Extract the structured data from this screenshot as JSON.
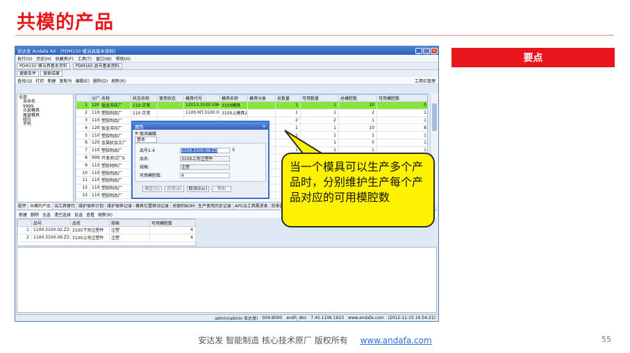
{
  "slide": {
    "title": "共模的产品",
    "key_points": "要点",
    "callout": "当一个模具可以生产多个产品时，分别维护生产每个产品对应的可用模腔数",
    "footer_text": "安达发 智能制造 核心技术原厂 版权所有",
    "footer_link": "www.andafa.com",
    "page_number": "55"
  },
  "app": {
    "title": "安达发 Andafa AX - [PDM150 模治具基本资料]",
    "menu": [
      "执行(O)",
      "历史(H)",
      "收藏夹(F)",
      "工具(T)",
      "窗口(W)",
      "帮助(H)"
    ],
    "doc_tabs": [
      "PDM150 模治具基本资料",
      "PDM160 品号基本资料"
    ],
    "sub_tabs": [
      "搜索条件",
      "搜索结果"
    ],
    "toolbar": [
      "查找(Q)",
      "打印",
      "新建",
      "复制为",
      "编辑(E)",
      "删除(D)",
      "刷新(R)"
    ],
    "toolbar_right": "工具栏管理",
    "tree": [
      "全部",
      "未命名",
      "9999",
      "头部模具",
      "尾部模具",
      "线位",
      "手机"
    ],
    "grid_headers": [
      "",
      "分厂",
      "名称",
      "状态名称",
      "使用状态",
      "模具代号",
      "模具名称",
      "模具分类",
      "总数量",
      "可用数量",
      "总模腔数",
      "可用模腔数"
    ],
    "grid_rows": [
      [
        "1",
        "1205",
        "钣金冲压厂",
        "110 正常",
        "",
        "12013.3100.59MT",
        "3100模具",
        "",
        "1",
        "1",
        "10",
        "0"
      ],
      [
        "2",
        "1100",
        "塑胶制品厂",
        "110 正常",
        "",
        "1100.MT.3100.01-2",
        "3100上模具2",
        "",
        "1",
        "1",
        "2",
        "1"
      ],
      [
        "3",
        "1100",
        "塑胶制品厂",
        "",
        "",
        "",
        "",
        "",
        "2",
        "2",
        "1",
        "1"
      ],
      [
        "4",
        "1205",
        "钣金冲压厂",
        "",
        "",
        "",
        "",
        "",
        "1",
        "1",
        "10",
        "8"
      ],
      [
        "5",
        "1100",
        "塑胶制品厂",
        "",
        "",
        "",
        "",
        "",
        "1",
        "1",
        "1",
        "1"
      ],
      [
        "6",
        "1202",
        "金属机加工厂",
        "",
        "",
        "",
        "",
        "",
        "1",
        "1",
        "0",
        "1"
      ],
      [
        "7",
        "1100",
        "塑胶制品厂",
        "",
        "",
        "",
        "",
        "",
        "1",
        "1",
        "1",
        "1"
      ],
      [
        "8",
        "9999",
        "开发测试厂b",
        "",
        "",
        "",
        "",
        "",
        "1",
        "1",
        "1",
        "1"
      ],
      [
        "9",
        "1103",
        "塑胶材料厂",
        "",
        "",
        "",
        "",
        "",
        "",
        "",
        "",
        ""
      ],
      [
        "10",
        "1100",
        "塑胶制品厂",
        "",
        "",
        "",
        "",
        "",
        "",
        "",
        "",
        ""
      ],
      [
        "11",
        "1100",
        "塑胶制品厂",
        "",
        "",
        "",
        "",
        "",
        "",
        "",
        "",
        ""
      ],
      [
        "12",
        "1100",
        "塑胶制品厂",
        "",
        "",
        "",
        "",
        "",
        "",
        "",
        "",
        ""
      ],
      [
        "13",
        "1100",
        "塑胶制品厂",
        "",
        "",
        "",
        "",
        "",
        "",
        "",
        "",
        ""
      ]
    ],
    "bottom_tabs": [
      "配件",
      "共模的产品",
      "冶工具替代",
      "维护保养计划",
      "维护保养记录",
      "模具位置移动记录",
      "关联的BOM",
      "生产使用历史记录",
      "APS冶工具需求表",
      "的来源"
    ],
    "sub_toolbar": [
      "新建",
      "删除",
      "全选",
      "清空选择",
      "反选",
      "查看",
      "刷新(R)"
    ],
    "sub_headers": [
      "",
      "品号",
      "品名",
      "规格",
      "可用模腔数"
    ],
    "sub_rows": [
      [
        "1",
        "1100.3100.02.Z3",
        "3100下壳注塑件",
        "注塑",
        "4"
      ],
      [
        "2",
        "1100.3100.09.Z3",
        "3100上壳注塑件",
        "注塑",
        "4"
      ]
    ],
    "status": [
      "admin(admin 安达发)",
      "S04:8090",
      "andh_dev",
      "7.45.1106.1623",
      "www.andafa.com",
      "(2012-11-15 16:54:21)"
    ]
  },
  "dialog": {
    "title": "属性",
    "tool": "取消编辑",
    "tab": "基本",
    "fields": [
      {
        "label": "品号1:4",
        "value": "1100.3100.09.Z3"
      },
      {
        "label": "品名:",
        "value": "3100上壳注塑件"
      },
      {
        "label": "规格:",
        "value": "注塑"
      },
      {
        "label": "可用模腔数:",
        "value": "4"
      }
    ],
    "buttons": [
      "确定(O)",
      "应用(A)",
      "取消(Esc)",
      "帮助"
    ]
  }
}
